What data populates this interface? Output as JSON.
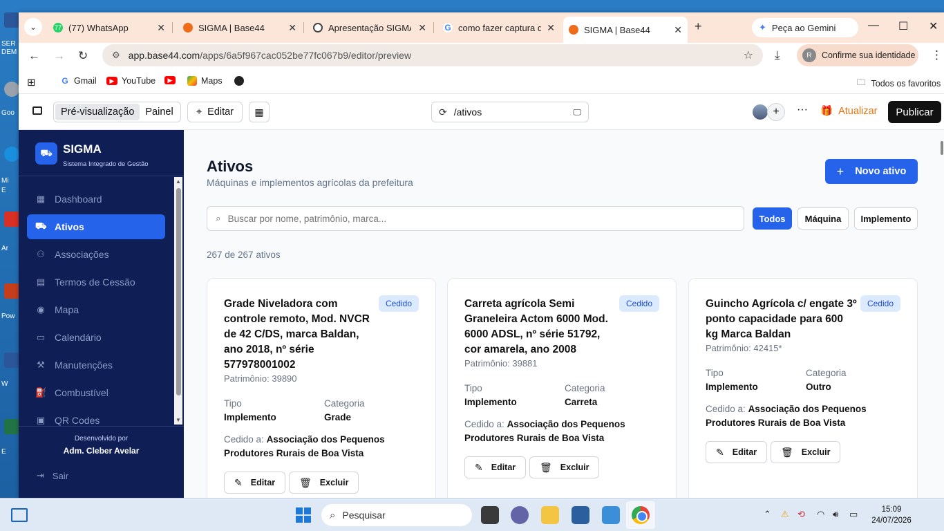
{
  "desktop": {
    "labels": [
      "SER",
      "DEM",
      "Goo",
      "Mi",
      "E",
      "Ar",
      "Pow",
      "W",
      "E"
    ]
  },
  "browser": {
    "tabs": [
      {
        "title": "(77) WhatsApp",
        "favicon": "whatsapp-icon",
        "color": "#25d366",
        "fav_text": "77"
      },
      {
        "title": "SIGMA | Base44",
        "favicon": "base44-icon",
        "color": "#ef6c1a"
      },
      {
        "title": "Apresentação SIGMA",
        "favicon": "openai-icon",
        "color": "#444444"
      },
      {
        "title": "como fazer captura de",
        "favicon": "google-icon",
        "color": "#4285f4"
      },
      {
        "title": "SIGMA | Base44",
        "favicon": "base44-icon",
        "color": "#ef6c1a",
        "active": true
      }
    ],
    "gemini_label": "Peça ao Gemini",
    "url_host": "app.base44.com",
    "url_path": "/apps/6a5f967cac052be77fc067b9/editor/preview",
    "identity_label": "Confirme sua identidade",
    "identity_initial": "R",
    "bookmarks": [
      {
        "label": "Gmail",
        "icon": "google-icon",
        "color": "#4285f4"
      },
      {
        "label": "YouTube",
        "icon": "youtube-icon",
        "color": "#ff0000"
      },
      {
        "label": "",
        "icon": "youtube-icon",
        "color": "#ff0000"
      },
      {
        "label": "Maps",
        "icon": "maps-icon",
        "color": "#34a853"
      },
      {
        "label": "",
        "icon": "globe-icon",
        "color": "#222222"
      }
    ],
    "all_favorites": "Todos os favoritos"
  },
  "editor": {
    "preview_label": "Pré-visualização",
    "panel_label": "Painel",
    "edit_label": "Editar",
    "route": "/ativos",
    "refresh_label": "Atualizar",
    "publish_label": "Publicar"
  },
  "sidebar": {
    "brand": "SIGMA",
    "subtitle": "Sistema Integrado de Gestão",
    "items": [
      {
        "label": "Dashboard",
        "icon": "grid-icon",
        "glyph": "▦"
      },
      {
        "label": "Ativos",
        "icon": "tractor-icon",
        "glyph": "⛟",
        "active": true
      },
      {
        "label": "Associações",
        "icon": "users-icon",
        "glyph": "👥"
      },
      {
        "label": "Termos de Cessão",
        "icon": "document-icon",
        "glyph": "▤"
      },
      {
        "label": "Mapa",
        "icon": "map-pin-icon",
        "glyph": "◉"
      },
      {
        "label": "Calendário",
        "icon": "calendar-icon",
        "glyph": "▭"
      },
      {
        "label": "Manutenções",
        "icon": "wrench-icon",
        "glyph": "🔧"
      },
      {
        "label": "Combustível",
        "icon": "fuel-icon",
        "glyph": "⛽"
      },
      {
        "label": "QR Codes",
        "icon": "qr-icon",
        "glyph": "▣"
      }
    ],
    "developed_by": "Desenvolvido por",
    "developer": "Adm. Cleber Avelar",
    "logout": "Sair"
  },
  "main": {
    "title": "Ativos",
    "subtitle": "Máquinas e implementos agrícolas da prefeitura",
    "new_button": "Novo ativo",
    "search_placeholder": "Buscar por nome, patrimônio, marca...",
    "filters": [
      "Todos",
      "Máquina",
      "Implemento"
    ],
    "active_filter": "Todos",
    "count_text": "267 de 267 ativos",
    "cards": [
      {
        "title": "Grade Niveladora com controle remoto, Mod. NVCR de 42 C/DS, marca Baldan, ano 2018, nº série 577978001002",
        "status": "Cedido",
        "patrimonio": "Patrimônio: 39890",
        "tipo_label": "Tipo",
        "tipo": "Implemento",
        "categoria_label": "Categoria",
        "categoria": "Grade",
        "cedido_label": "Cedido a:",
        "cedido": "Associação dos Pequenos Produtores Rurais de Boa Vista",
        "edit": "Editar",
        "delete": "Excluir"
      },
      {
        "title": "Carreta agrícola Semi Graneleira Actom 6000 Mod. 6000 ADSL, nº série 51792, cor amarela, ano 2008",
        "status": "Cedido",
        "patrimonio": "Patrimônio: 39881",
        "tipo_label": "Tipo",
        "tipo": "Implemento",
        "categoria_label": "Categoria",
        "categoria": "Carreta",
        "cedido_label": "Cedido a:",
        "cedido": "Associação dos Pequenos Produtores Rurais de Boa Vista",
        "edit": "Editar",
        "delete": "Excluir"
      },
      {
        "title": "Guincho Agrícola c/ engate 3º ponto capacidade para 600 kg Marca Baldan",
        "status": "Cedido",
        "patrimonio": "Patrimônio: 42415*",
        "tipo_label": "Tipo",
        "tipo": "Implemento",
        "categoria_label": "Categoria",
        "categoria": "Outro",
        "cedido_label": "Cedido a:",
        "cedido": "Associação dos Pequenos Produtores Rurais de Boa Vista",
        "edit": "Editar",
        "delete": "Excluir"
      }
    ]
  },
  "taskbar": {
    "search_label": "Pesquisar",
    "time": "15:09",
    "date": "24/07/2026"
  },
  "colors": {
    "accent": "#2563eb",
    "sidebar_bg": "#0f1f55",
    "refresh": "#e8720c",
    "badge_bg": "#dbeafe",
    "badge_text": "#1d4ed8"
  }
}
